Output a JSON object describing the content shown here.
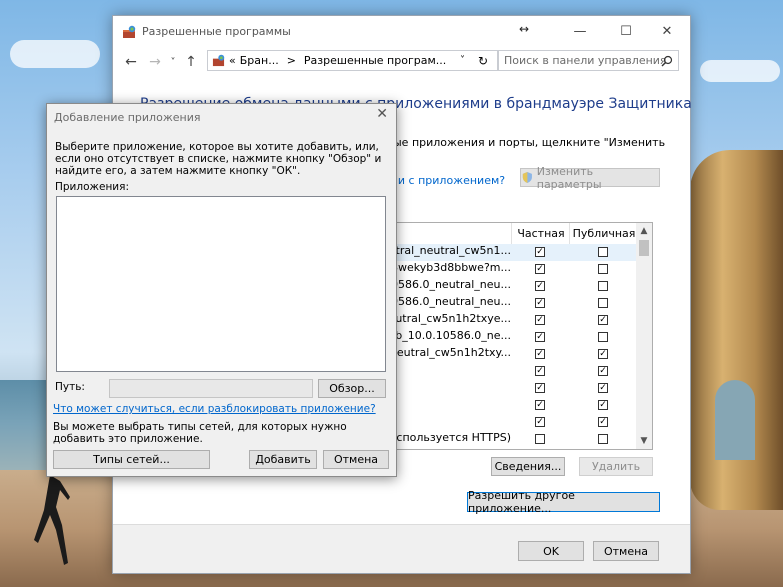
{
  "colors": {
    "heading": "#1e3d8b",
    "link": "#0066cc",
    "accent": "#0078d7"
  },
  "main_window": {
    "title": "Разрешенные программы",
    "resize_icon": "↔",
    "minimize_glyph": "—",
    "maximize_glyph": "☐",
    "close_glyph": "✕",
    "nav": {
      "back": "←",
      "forward": "→",
      "dropdown": "˅",
      "up": "↑"
    },
    "address": {
      "prefix": "«",
      "crumb1": "Бран...",
      "separator": ">",
      "crumb2": "Разрешенные програм...",
      "dropdown": "˅",
      "refresh": "↻"
    },
    "search_placeholder": "Поиск в панели управления",
    "heading": "Разрешение обмена данными с приложениями в брандмауэре Защитника",
    "description": "ые приложения и порты, щелкните \"Изменить",
    "link": "ями с приложением?",
    "change_settings_label": "Изменить параметры",
    "table": {
      "columns": {
        "private": "Частная",
        "public": "Публичная"
      },
      "rows": [
        {
          "name": "neutral_neutral_cw5n1...",
          "private": true,
          "public": false
        },
        {
          "name": "l__8wekyb3d8bbwe?m...",
          "private": true,
          "public": false
        },
        {
          "name": ".0.10586.0_neutral_neu...",
          "private": true,
          "public": false
        },
        {
          "name": ".0.10586.0_neutral_neu...",
          "private": true,
          "public": false
        },
        {
          "name": "neutral_cw5n1h2txye...",
          "private": true,
          "public": true
        },
        {
          "name": "erHub_10.0.10586.0_ne...",
          "private": true,
          "public": false
        },
        {
          "name": "al_neutral_cw5n1h2txy...",
          "private": true,
          "public": true
        },
        {
          "name": "",
          "private": true,
          "public": true
        },
        {
          "name": "",
          "private": true,
          "public": true
        },
        {
          "name": "",
          "private": true,
          "public": true
        },
        {
          "name": "",
          "private": true,
          "public": true
        },
        {
          "name": "спользуется HTTPS)",
          "private": false,
          "public": false
        }
      ]
    },
    "details_label": "Сведения...",
    "delete_label": "Удалить",
    "allow_other_label": "Разрешить другое приложение...",
    "ok_label": "OK",
    "cancel_label": "Отмена"
  },
  "dialog": {
    "title": "Добавление приложения",
    "close_glyph": "✕",
    "description": "Выберите приложение, которое вы хотите добавить, или, если оно отсутствует в списке, нажмите кнопку \"Обзор\" и найдите его, а затем нажмите кнопку \"ОК\".",
    "apps_label": "Приложения:",
    "path_label": "Путь:",
    "path_value": "",
    "browse_label": "Обзор...",
    "block_link": "Что может случиться, если разблокировать приложение?",
    "network_note": "Вы можете выбрать типы сетей, для которых нужно добавить это приложение.",
    "network_types_label": "Типы сетей...",
    "add_label": "Добавить",
    "cancel_label": "Отмена"
  }
}
